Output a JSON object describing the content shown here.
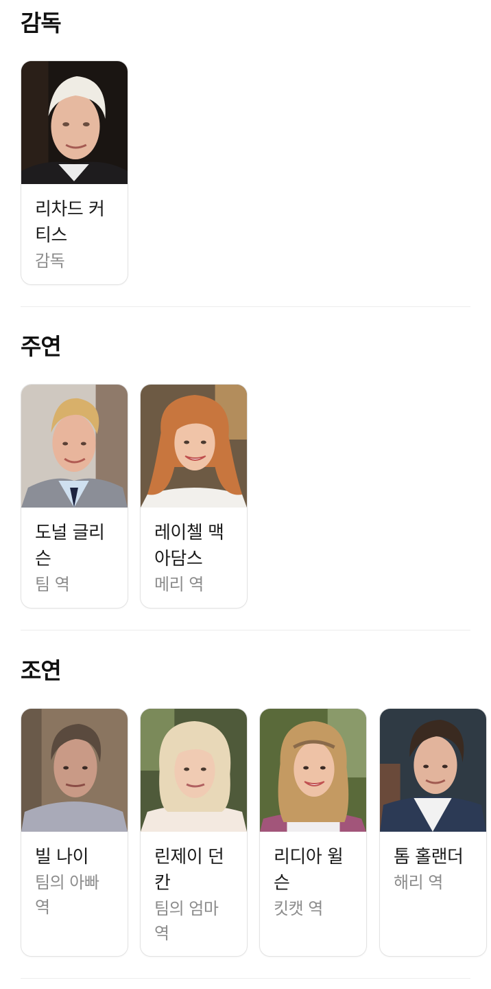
{
  "sections": [
    {
      "title": "감독",
      "people": [
        {
          "name": "리차드 커티스",
          "name_lines": [
            "리차드 커",
            "티스"
          ],
          "role_lines": [
            "감독"
          ],
          "photo": "director-photo"
        }
      ]
    },
    {
      "title": "주연",
      "people": [
        {
          "name": "도널 글리슨",
          "name_lines": [
            "도널 글리",
            "슨"
          ],
          "role_lines": [
            "팀 역"
          ],
          "photo": "actor-photo"
        },
        {
          "name": "레이첼 맥아담스",
          "name_lines": [
            "레이첼 맥",
            "아담스"
          ],
          "role_lines": [
            "메리 역"
          ],
          "photo": "actor-photo"
        }
      ]
    },
    {
      "title": "조연",
      "people": [
        {
          "name": "빌 나이",
          "name_lines": [
            "빌 나이"
          ],
          "role_lines": [
            "팀의 아빠",
            "역"
          ],
          "photo": "actor-photo"
        },
        {
          "name": "린제이 던칸",
          "name_lines": [
            "린제이 던",
            "칸"
          ],
          "role_lines": [
            "팀의 엄마",
            "역"
          ],
          "photo": "actor-photo"
        },
        {
          "name": "리디아 윌슨",
          "name_lines": [
            "리디아 윌",
            "슨"
          ],
          "role_lines": [
            "킷캣 역"
          ],
          "photo": "actor-photo"
        },
        {
          "name": "톰 홀랜더",
          "name_lines": [
            "톰 홀랜더"
          ],
          "role_lines": [
            "해리 역"
          ],
          "photo": "actor-photo"
        }
      ]
    }
  ]
}
